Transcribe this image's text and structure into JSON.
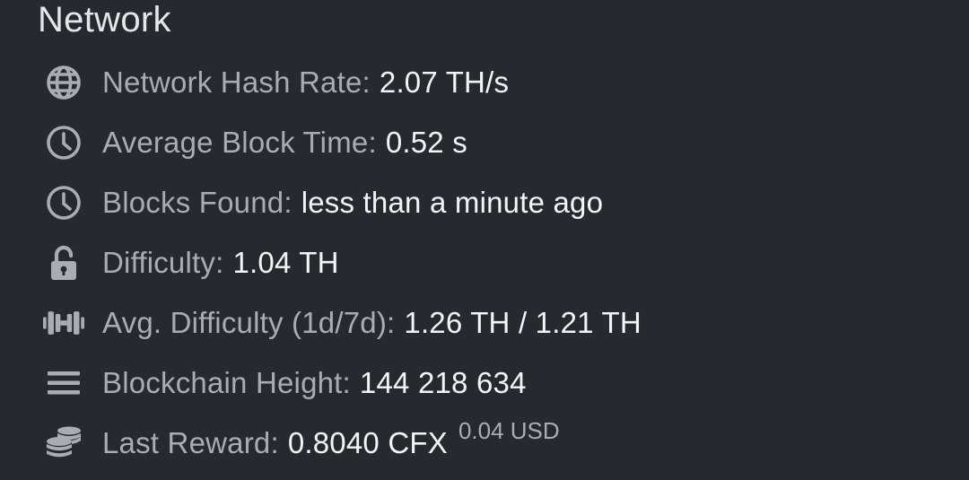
{
  "network": {
    "title": "Network",
    "stats": [
      {
        "icon": "globe-icon",
        "label": "Network Hash Rate:",
        "value": "2.07 TH/s"
      },
      {
        "icon": "clock-icon",
        "label": "Average Block Time:",
        "value": "0.52 s"
      },
      {
        "icon": "clock-icon",
        "label": "Blocks Found:",
        "value": "less than a minute ago"
      },
      {
        "icon": "unlock-icon",
        "label": "Difficulty:",
        "value": "1.04 TH"
      },
      {
        "icon": "dumbbell-icon",
        "label": "Avg. Difficulty (1d/7d):",
        "value": "1.26 TH / 1.21 TH"
      },
      {
        "icon": "bars-icon",
        "label": "Blockchain Height:",
        "value": "144 218 634"
      },
      {
        "icon": "coins-icon",
        "label": "Last Reward:",
        "value": "0.8040 CFX",
        "sub": "0.04 USD"
      }
    ]
  },
  "colors": {
    "background": "#27292e",
    "label": "#a9adb3",
    "value": "#f4f5f7",
    "icon": "#a9adb3"
  }
}
